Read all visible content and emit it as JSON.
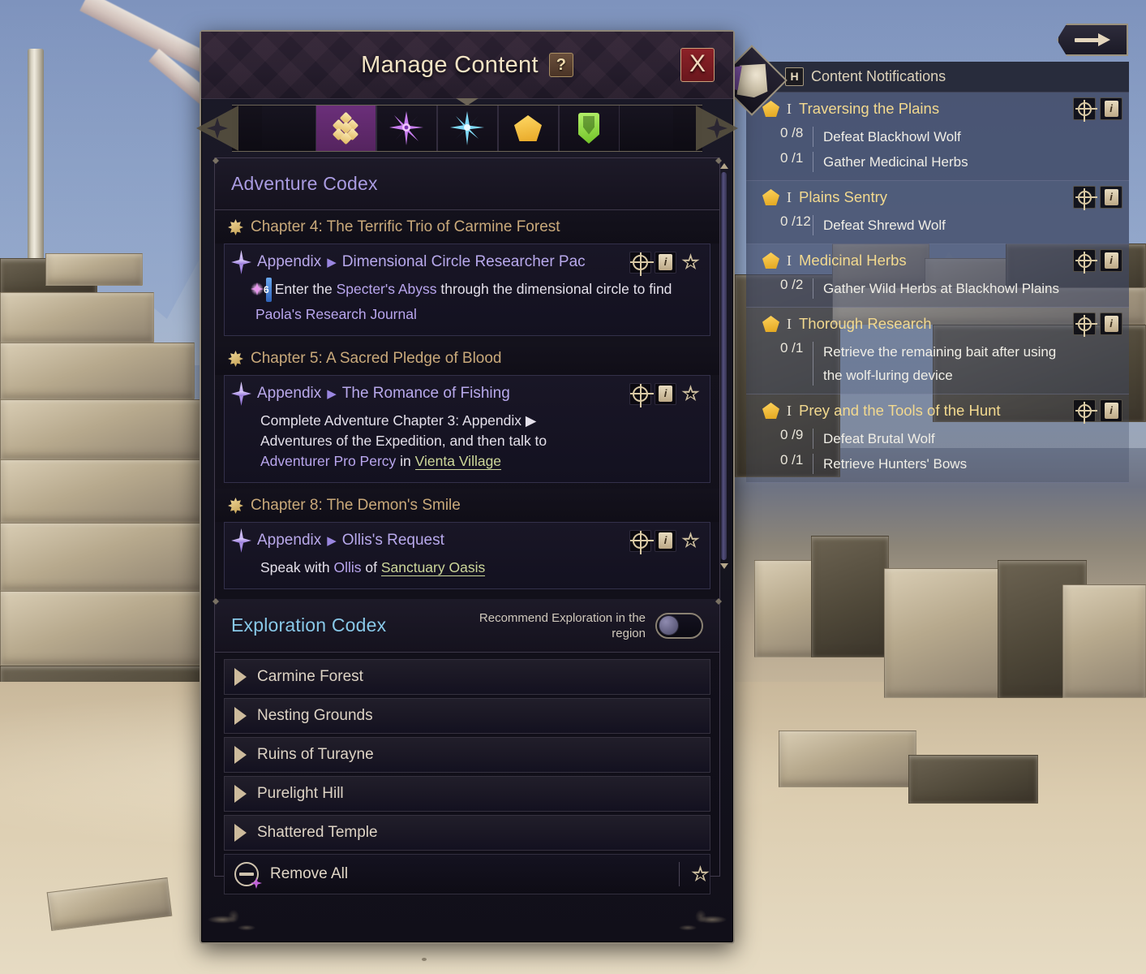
{
  "window": {
    "title": "Manage Content",
    "help_label": "?",
    "close_label": "X"
  },
  "tabs": [
    {
      "name": "tab-adventure",
      "icon": "gold-diamonds-icon",
      "active": true
    },
    {
      "name": "tab-purple-star",
      "icon": "purple-star-icon",
      "active": false
    },
    {
      "name": "tab-blue-star",
      "icon": "blue-star-icon",
      "active": false
    },
    {
      "name": "tab-pentagon",
      "icon": "gold-pentagon-icon",
      "active": false
    },
    {
      "name": "tab-banner",
      "icon": "green-banner-icon",
      "active": false
    }
  ],
  "adventure_codex": {
    "title": "Adventure Codex",
    "chapters": [
      {
        "label": "Chapter 4: The Terrific Trio of Carmine Forest",
        "entry": {
          "kind": "Appendix",
          "arrow": "▶",
          "name": "Dimensional Circle Researcher Pac",
          "objective_pre": "Enter the ",
          "objective_link1": "Specter's Abyss",
          "objective_mid": " through the dimensional circle to find ",
          "objective_link2": "Paola's Research Journal",
          "level": "6"
        }
      },
      {
        "label": "Chapter 5: A Sacred Pledge of Blood",
        "entry": {
          "kind": "Appendix",
          "arrow": "▶",
          "name": "The Romance of Fishing",
          "objective_l1": "Complete Adventure Chapter 3: Appendix ▶",
          "objective_l2": "Adventures of the Expedition, and then talk to",
          "objective_l3_link1": "Adventurer Pro Percy",
          "objective_l3_mid": " in ",
          "objective_l3_link2": "Vienta Village"
        }
      },
      {
        "label": "Chapter 8: The Demon's Smile",
        "entry": {
          "kind": "Appendix",
          "arrow": "▶",
          "name": "Ollis's Request",
          "objective_pre": "Speak with ",
          "objective_link1": "Ollis",
          "objective_mid": " of ",
          "objective_link2": "Sanctuary Oasis"
        }
      }
    ]
  },
  "exploration_codex": {
    "title": "Exploration Codex",
    "toggle_label": "Recommend Exploration in the region",
    "toggle_on": false,
    "regions": [
      {
        "name": "Carmine Forest"
      },
      {
        "name": "Nesting Grounds"
      },
      {
        "name": "Ruins of Turayne"
      },
      {
        "name": "Purelight Hill"
      },
      {
        "name": "Shattered Temple"
      }
    ],
    "remove_all_label": "Remove All"
  },
  "tracker": {
    "hotkey": "H",
    "title": "Content Notifications",
    "quests": [
      {
        "rank": "I",
        "name": "Traversing the Plains",
        "objectives": [
          {
            "count": "0 /8",
            "text": "Defeat Blackhowl Wolf"
          },
          {
            "count": "0 /1",
            "text": "Gather Medicinal Herbs"
          }
        ]
      },
      {
        "rank": "I",
        "name": "Plains Sentry",
        "objectives": [
          {
            "count": "0 /12",
            "text": "Defeat Shrewd Wolf"
          }
        ]
      },
      {
        "rank": "I",
        "name": "Medicinal Herbs",
        "objectives": [
          {
            "count": "0 /2",
            "text": "Gather Wild Herbs at Blackhowl Plains"
          }
        ]
      },
      {
        "rank": "I",
        "name": "Thorough Research",
        "objectives": [
          {
            "count": "0 /1",
            "text": "Retrieve the remaining bait after using the wolf-luring device"
          }
        ]
      },
      {
        "rank": "I",
        "name": "Prey and the Tools of the Hunt",
        "objectives": [
          {
            "count": "0 /9",
            "text": "Defeat Brutal Wolf"
          },
          {
            "count": "0 /1",
            "text": "Retrieve Hunters' Bows"
          }
        ]
      }
    ]
  },
  "colors": {
    "accent_purple": "#b8a9ec",
    "accent_gold": "#f2d98f",
    "chapter_gold": "#c9a97a",
    "link_green": "#cdd79a",
    "close_red": "#8c2128"
  }
}
